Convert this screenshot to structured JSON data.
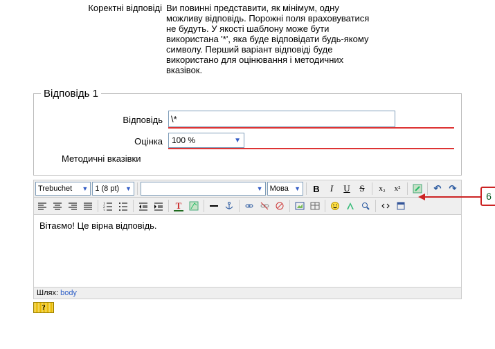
{
  "help": {
    "label": "Коректні відповіді",
    "text": "Ви повинні представити, як мінімум, одну можливу відповідь. Порожні поля враховуватися не будуть. У якості шаблону може бути використана '*', яка буде відповідати будь-якому символу. Перший варіант відповіді буде використано для оцінювання і методичних вказівок."
  },
  "fieldset": {
    "legend": "Відповідь 1",
    "answer_label": "Відповідь",
    "answer_value": "\\*",
    "grade_label": "Оцінка",
    "grade_value": "100 %",
    "feedback_label": "Методичні вказівки"
  },
  "editor": {
    "font_family": "Trebuchet",
    "font_size": "1 (8 pt)",
    "style": "",
    "lang": "Мова",
    "content": "Вітаємо! Це вірна відповідь.",
    "path_label": "Шлях:",
    "path_value": "body"
  },
  "callout": {
    "number": "6"
  },
  "help_toggle_glyph": "?"
}
